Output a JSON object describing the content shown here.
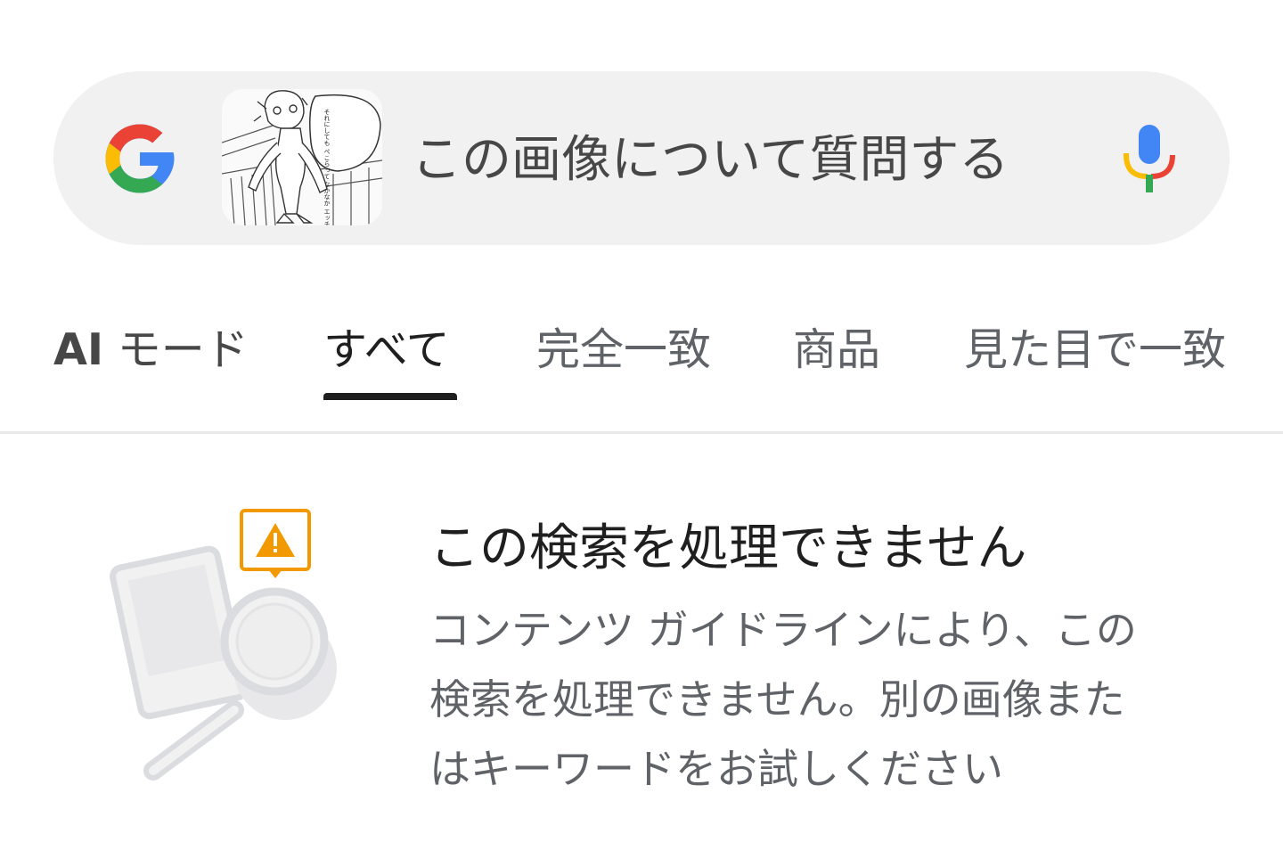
{
  "search": {
    "query_placeholder": "この画像について質問する",
    "thumbnail_text": "それにしても ぺこらって なかなか エッチだよな"
  },
  "tabs": [
    {
      "label_ai": "AI",
      "label_rest": " モード"
    },
    {
      "label": "すべて",
      "selected": true
    },
    {
      "label": "完全一致"
    },
    {
      "label": "商品"
    },
    {
      "label": "見た目で一致"
    }
  ],
  "error": {
    "title": "この検索を処理できません",
    "body_lines": [
      "コンテンツ ガイドラインにより、この",
      "検索を処理できません。別の画像また",
      "はキーワードをお試しください"
    ]
  },
  "colors": {
    "searchbar_bg": "#f1f1f1",
    "warning": "#f29900",
    "mic_blue": "#4285f4",
    "mic_red": "#ea4335",
    "mic_yellow": "#fbbc04",
    "mic_green": "#34a853",
    "selected_tab": "#1f1f1f"
  }
}
